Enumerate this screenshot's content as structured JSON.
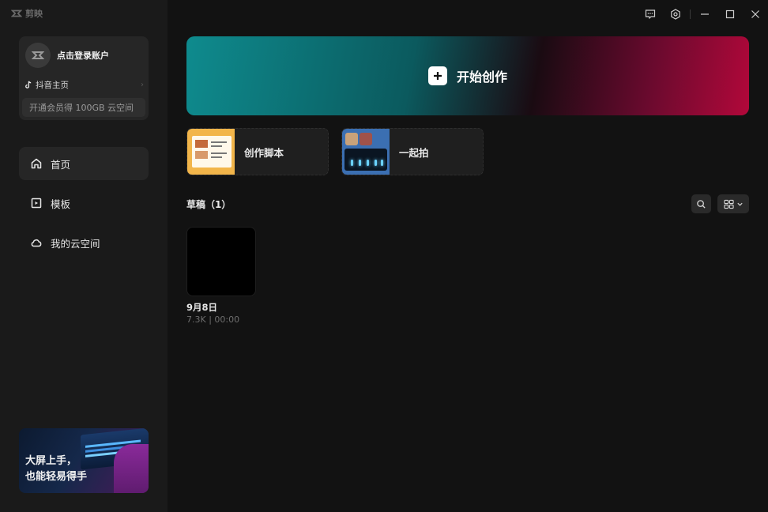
{
  "app": {
    "logo_text": "剪映"
  },
  "account": {
    "login_label": "点击登录账户",
    "douyin_label": "抖音主页",
    "vip_label": "开通会员得 100GB 云空间"
  },
  "nav": {
    "items": [
      {
        "label": "首页",
        "icon": "home-icon",
        "active": true
      },
      {
        "label": "模板",
        "icon": "template-icon",
        "active": false
      },
      {
        "label": "我的云空间",
        "icon": "cloud-icon",
        "active": false
      }
    ]
  },
  "promo": {
    "line1": "大屏上手，",
    "line2": "也能轻易得手"
  },
  "hero": {
    "label": "开始创作"
  },
  "quick_actions": {
    "script_label": "创作脚本",
    "shoot_label": "一起拍"
  },
  "drafts": {
    "title": "草稿（1）",
    "items": [
      {
        "name": "9月8日",
        "meta": "7.3K | 00:00"
      }
    ]
  },
  "colors": {
    "background": "#121212",
    "sidebar": "#1a1a1a",
    "hero_left": "#0e8b8e",
    "hero_right": "#b2083a"
  }
}
